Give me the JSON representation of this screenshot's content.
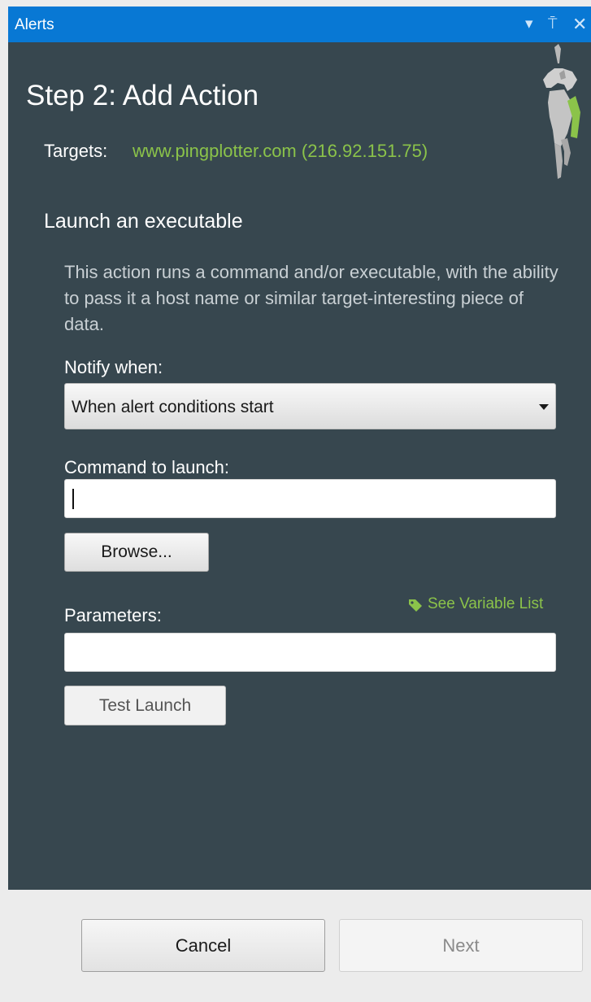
{
  "window": {
    "title": "Alerts",
    "controls": {
      "dropdown_icon": "▾",
      "pin_icon": "⍑",
      "close_icon": "✕"
    }
  },
  "wizard": {
    "step_title": "Step 2:  Add Action",
    "targets_label": "Targets:",
    "targets_value": "www.pingplotter.com (216.92.151.75)"
  },
  "action": {
    "title": "Launch an executable",
    "description": "This action runs a command and/or executable, with the ability to pass it a host name or similar target-interesting piece of data.",
    "notify_label": "Notify when:",
    "notify_selected": "When alert conditions start",
    "command_label": "Command to launch:",
    "command_value": "",
    "browse_label": "Browse...",
    "parameters_label": "Parameters:",
    "parameters_value": "",
    "variable_link": "See Variable List",
    "test_launch_label": "Test Launch"
  },
  "footer": {
    "cancel_label": "Cancel",
    "next_label": "Next"
  },
  "colors": {
    "title_bar": "#0878d4",
    "panel_bg": "#37474f",
    "accent_green": "#8bc34a",
    "footer_bg": "#ececec"
  }
}
